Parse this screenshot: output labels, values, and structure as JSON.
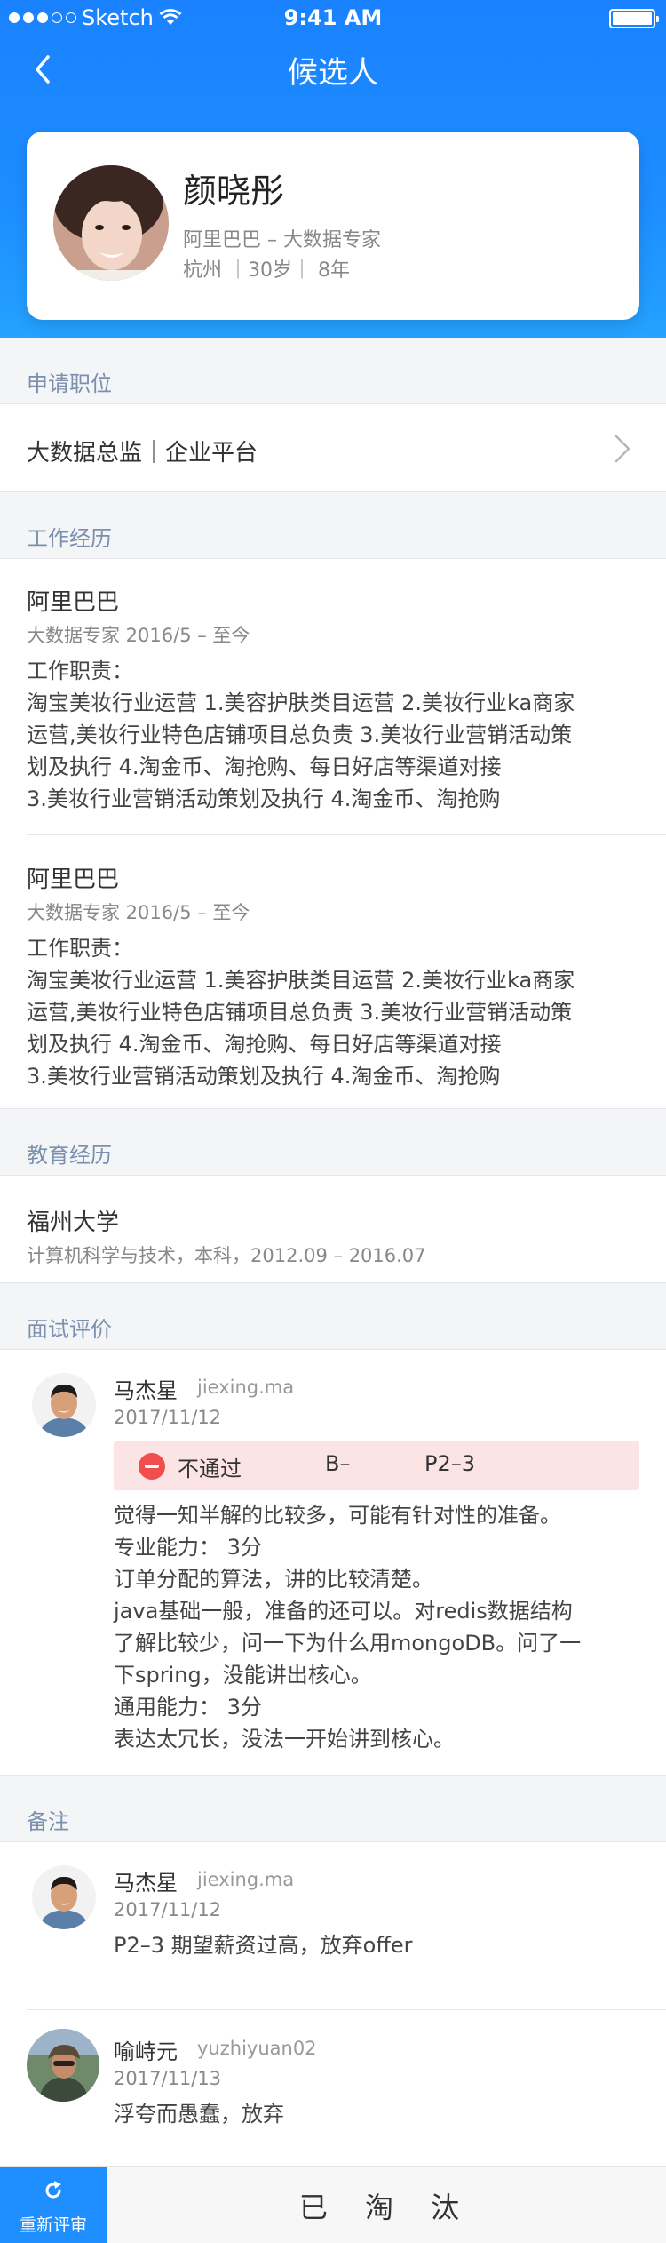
{
  "status_bar": {
    "carrier": "Sketch",
    "time": "9:41 AM"
  },
  "nav": {
    "title": "候选人"
  },
  "profile": {
    "name": "颜晓彤",
    "company_title": "阿里巴巴 – 大数据专家",
    "meta": "杭州 ｜30岁｜ 8年"
  },
  "position": {
    "section_label": "申请职位",
    "value": "大数据总监｜企业平台"
  },
  "work": {
    "section_label": "工作经历",
    "items": [
      {
        "company": "阿里巴巴",
        "role_period": "大数据专家 2016/5 – 至今",
        "duty_label": "工作职责：",
        "duty_lines": [
          "淘宝美妆行业运营 1.美容护肤类目运营 2.美妆行业ka商家",
          "运营,美妆行业特色店铺项目总负责 3.美妆行业营销活动策",
          "划及执行 4.淘金币、淘抢购、每日好店等渠道对接",
          "3.美妆行业营销活动策划及执行 4.淘金币、淘抢购"
        ]
      },
      {
        "company": "阿里巴巴",
        "role_period": "大数据专家 2016/5 – 至今",
        "duty_label": "工作职责：",
        "duty_lines": [
          "淘宝美妆行业运营 1.美容护肤类目运营 2.美妆行业ka商家",
          "运营,美妆行业特色店铺项目总负责 3.美妆行业营销活动策",
          "划及执行 4.淘金币、淘抢购、每日好店等渠道对接",
          "3.美妆行业营销活动策划及执行 4.淘金币、淘抢购"
        ]
      }
    ]
  },
  "education": {
    "section_label": "教育经历",
    "school": "福州大学",
    "detail": "计算机科学与技术，本科，2012.09 – 2016.07"
  },
  "interview": {
    "section_label": "面试评价",
    "reviewer_name": "马杰星",
    "reviewer_id": "jiexing.ma",
    "date": "2017/11/12",
    "result": "不通过",
    "grade": "B–",
    "level": "P2–3",
    "lines": [
      "觉得一知半解的比较多，可能有针对性的准备。",
      "专业能力：  3分",
      "订单分配的算法，讲的比较清楚。",
      "java基础一般，准备的还可以。对redis数据结构",
      "了解比较少，问一下为什么用mongoDB。问了一",
      "下spring，没能讲出核心。",
      "通用能力：  3分",
      "表达太冗长，没法一开始讲到核心。"
    ]
  },
  "notes": {
    "section_label": "备注",
    "items": [
      {
        "name": "马杰星",
        "id": "jiexing.ma",
        "date": "2017/11/12",
        "text": "P2–3 期望薪资过高，放弃offer"
      },
      {
        "name": "喻峙元",
        "id": "yuzhiyuan02",
        "date": "2017/11/13",
        "text": "浮夸而愚蠢，放弃"
      }
    ]
  },
  "bottom_bar": {
    "rescore_label": "重新评审",
    "status_label": "已 淘 汰"
  },
  "colors": {
    "brand_blue": "#1f8fff",
    "section_label": "#7b8fae",
    "reject_bg": "#fde4e4",
    "reject_icon": "#f24d4d"
  }
}
